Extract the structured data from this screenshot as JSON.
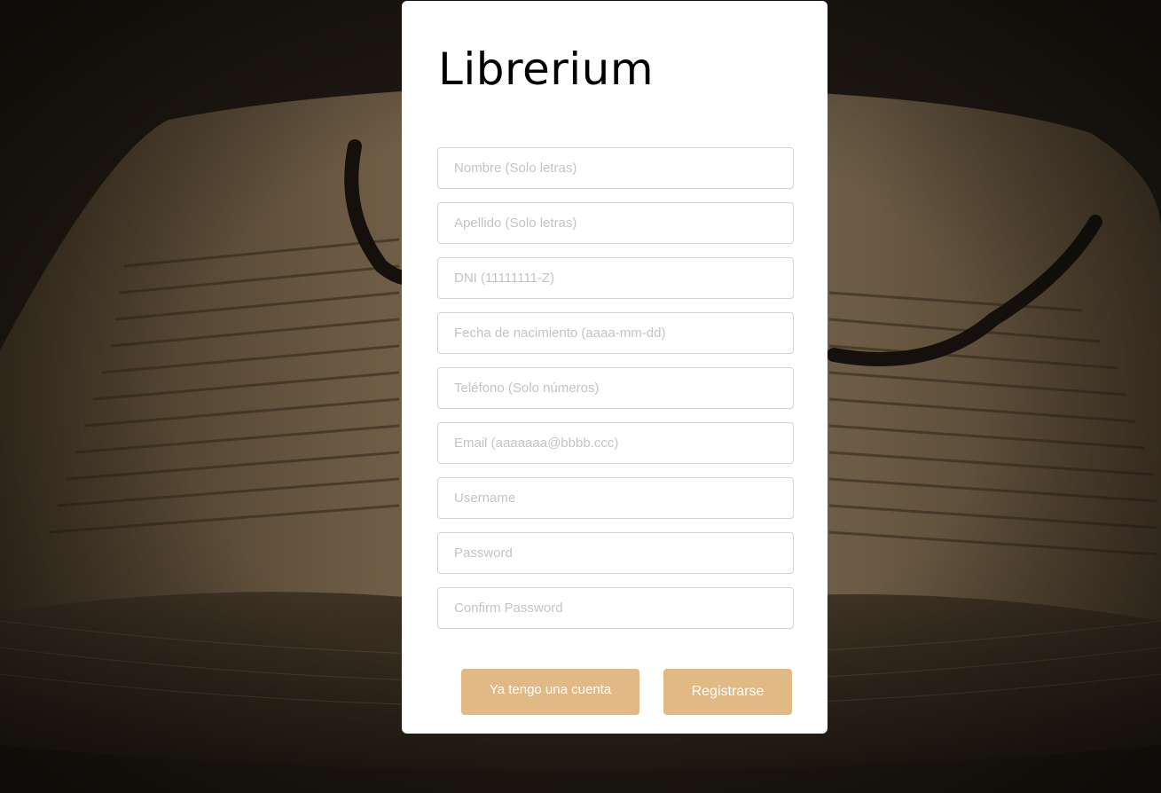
{
  "app": {
    "title": "Librerium"
  },
  "form": {
    "fields": [
      {
        "name": "nombre",
        "placeholder": "Nombre (Solo letras)",
        "value": ""
      },
      {
        "name": "apellido",
        "placeholder": "Apellido (Solo letras)",
        "value": ""
      },
      {
        "name": "dni",
        "placeholder": "DNI (11111111-Z)",
        "value": ""
      },
      {
        "name": "fecha",
        "placeholder": "Fecha de nacimiento (aaaa-mm-dd)",
        "value": ""
      },
      {
        "name": "telefono",
        "placeholder": "Teléfono (Solo números)",
        "value": ""
      },
      {
        "name": "email",
        "placeholder": "Email (aaaaaaa@bbbb.ccc)",
        "value": ""
      },
      {
        "name": "username",
        "placeholder": "Username",
        "value": ""
      },
      {
        "name": "password",
        "placeholder": "Password",
        "value": ""
      },
      {
        "name": "confirm",
        "placeholder": "Confirm Password",
        "value": ""
      }
    ],
    "buttons": {
      "login_label": "Ya tengo una cuenta",
      "register_label": "Registrarse"
    }
  },
  "colors": {
    "accent": "#e0b984",
    "card_background": "#ffffff",
    "field_border": "#d4d4d4",
    "placeholder": "#c4c4c4"
  }
}
